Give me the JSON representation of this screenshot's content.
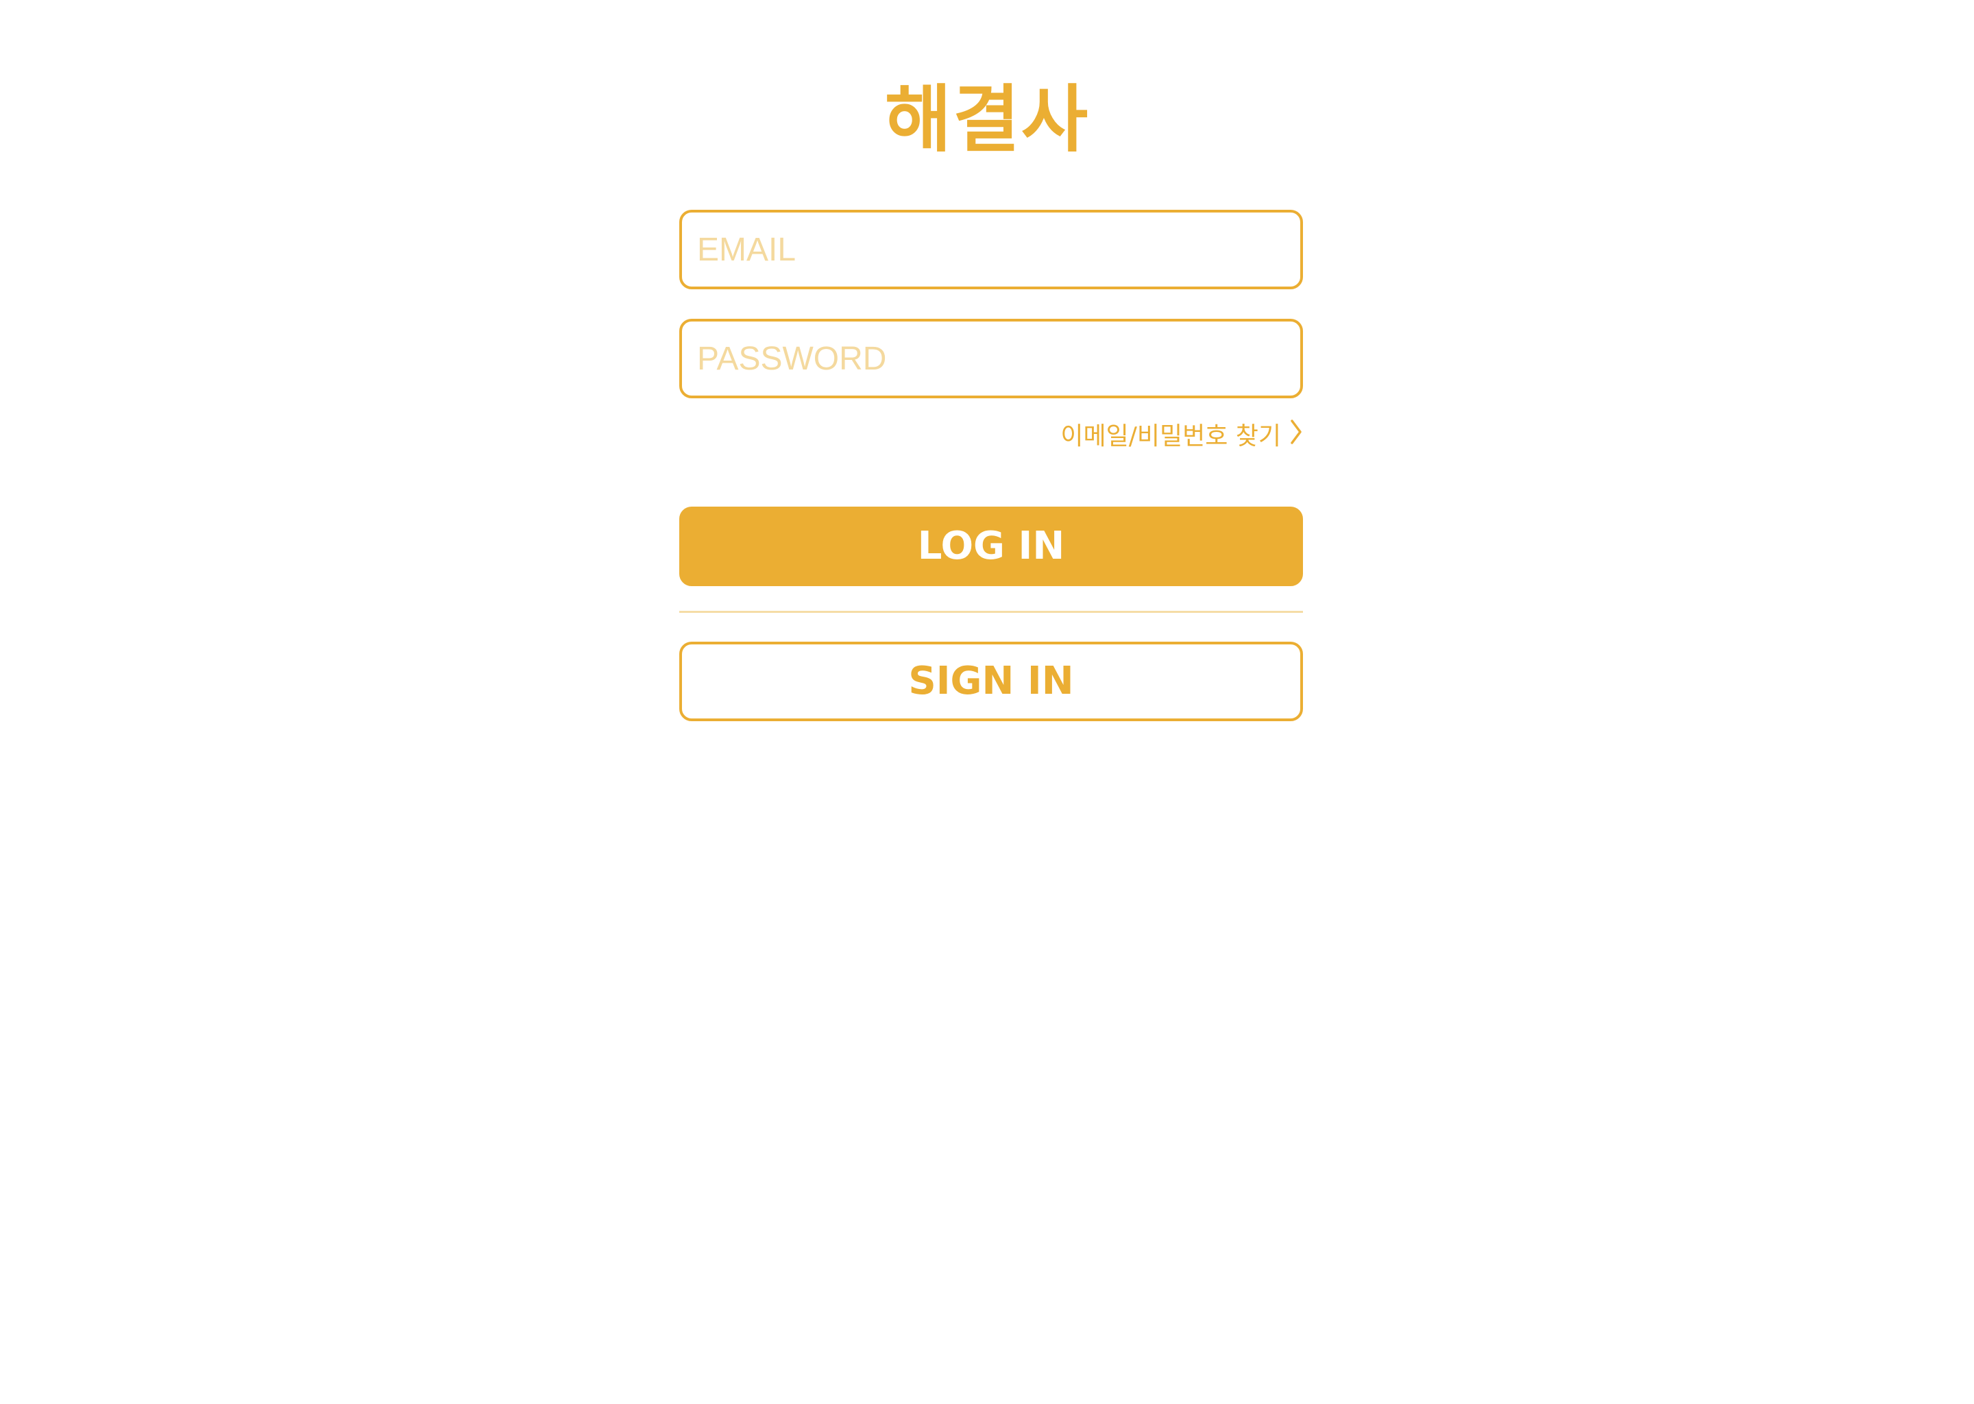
{
  "app": {
    "logo_text": "해결사"
  },
  "form": {
    "email_placeholder": "EMAIL",
    "password_placeholder": "PASSWORD",
    "find_account_label": "이메일/비밀번호 찾기",
    "find_account_icon": "chevron-right-icon",
    "login_label": "LOG IN",
    "signin_label": "SIGN IN"
  },
  "colors": {
    "accent": "#EBAE33",
    "placeholder": "#F4D99E",
    "divider": "#F5DDA6",
    "background": "#FFFFFF"
  }
}
